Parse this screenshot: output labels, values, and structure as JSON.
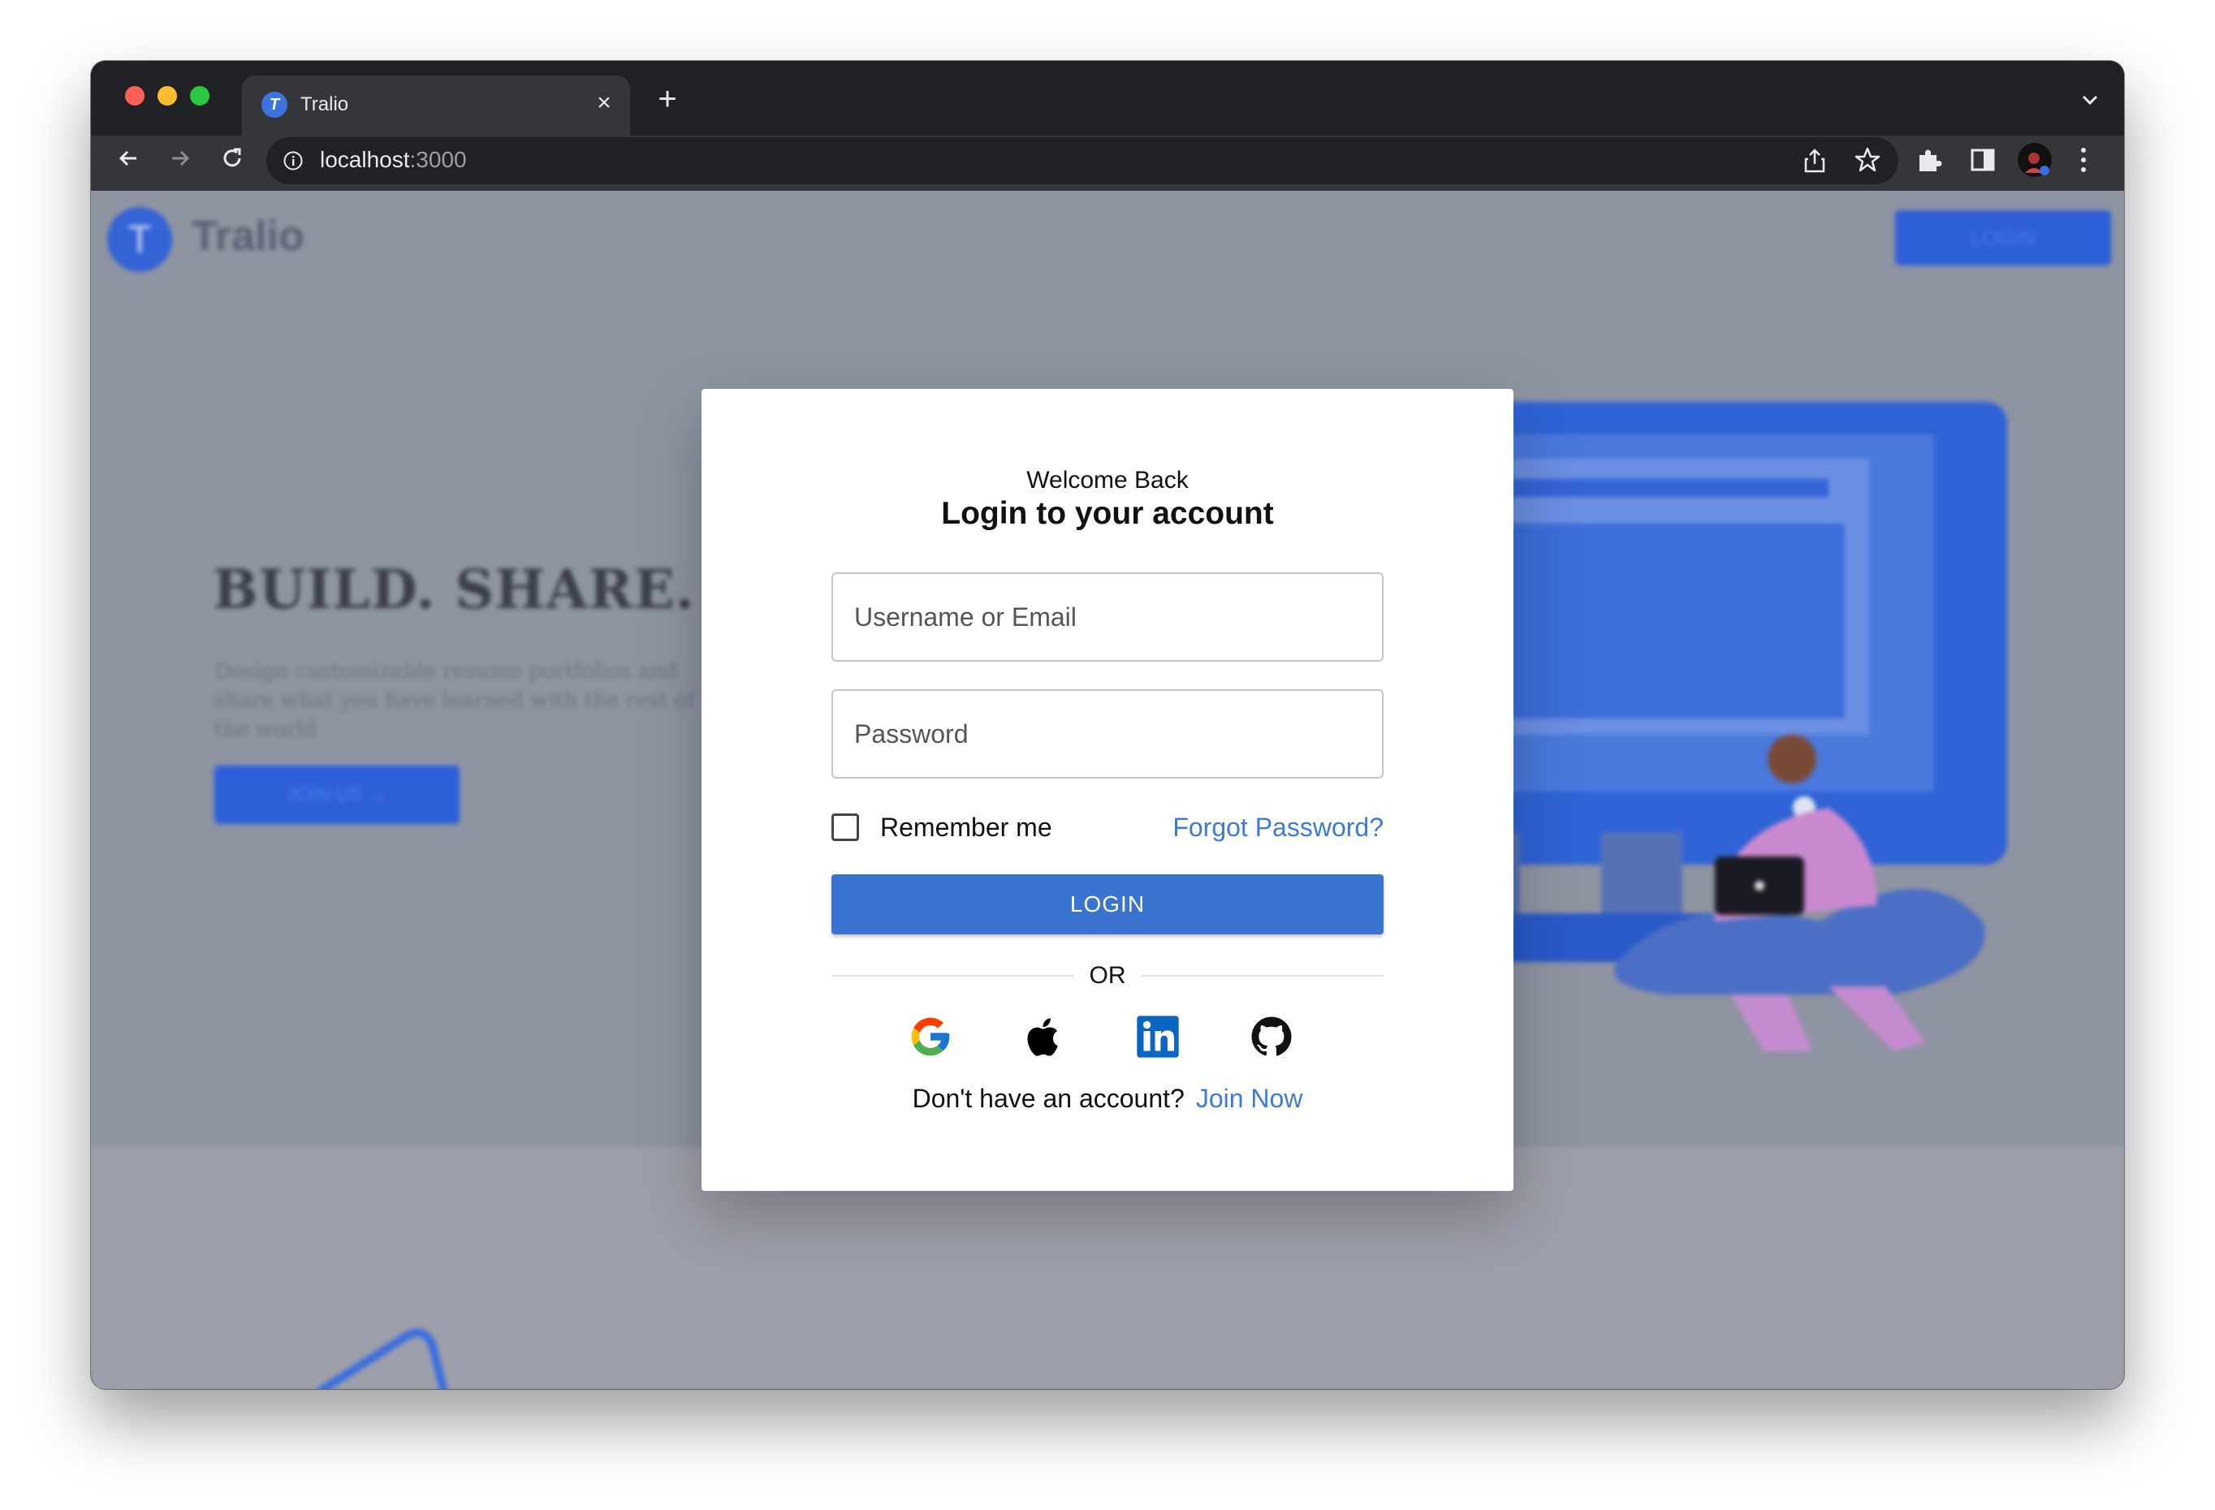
{
  "browser": {
    "tab_title": "Tralio",
    "favicon_letter": "T",
    "url_host": "localhost",
    "url_port": ":3000"
  },
  "background_page": {
    "logo_letter": "T",
    "brand": "Tralio",
    "login_button": "LOGIN",
    "headline": "BUILD. SHARE. MA",
    "subtext": "Design customizable resume portfolios and share what you have learned with the rest of the world",
    "join_button": "JOIN US →"
  },
  "login_modal": {
    "welcome": "Welcome Back",
    "title": "Login to your account",
    "username_placeholder": "Username or Email",
    "password_placeholder": "Password",
    "remember_label": "Remember me",
    "forgot_link": "Forgot Password?",
    "login_button": "LOGIN",
    "divider_text": "OR",
    "social_icons": [
      "google-icon",
      "apple-icon",
      "linkedin-icon",
      "github-icon"
    ],
    "signup_prompt": "Don't have an account?",
    "signup_link": "Join Now"
  },
  "colors": {
    "primary": "#3a72cf",
    "link": "#3b7ae0",
    "overlay": "#8f94a3"
  }
}
